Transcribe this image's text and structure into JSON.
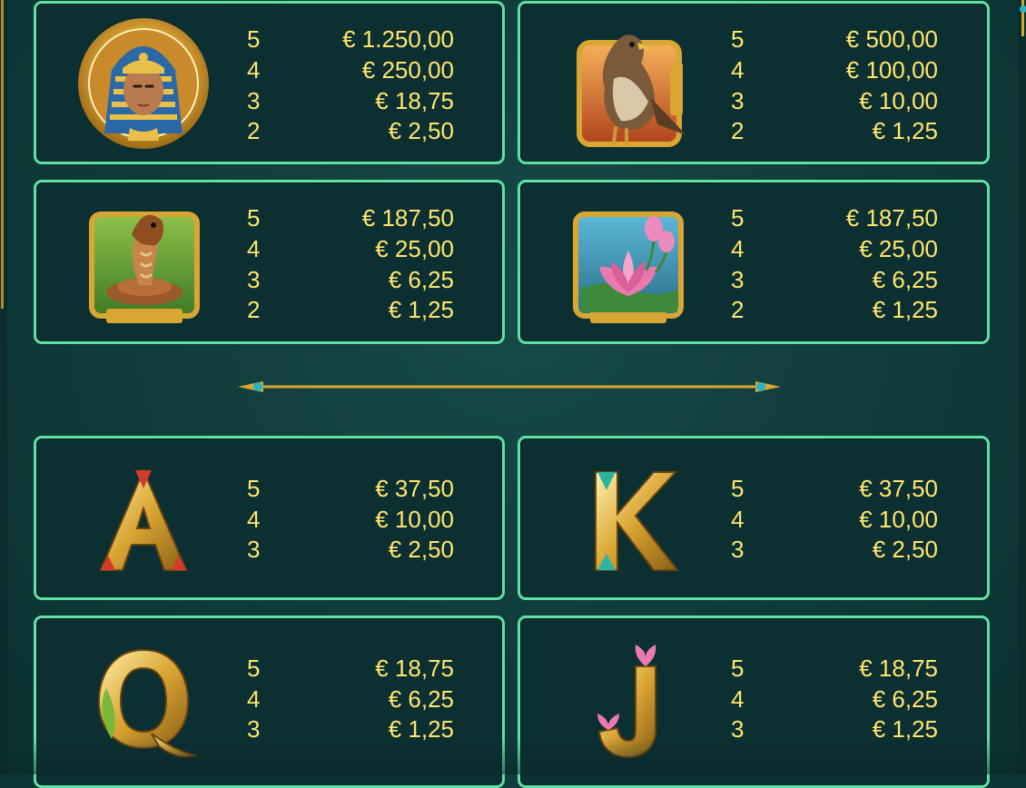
{
  "paytable": {
    "cards": [
      {
        "symbol": "pharaoh-icon",
        "rows": [
          {
            "count": "5",
            "amount": "€ 1.250,00"
          },
          {
            "count": "4",
            "amount": "€ 250,00"
          },
          {
            "count": "3",
            "amount": "€ 18,75"
          },
          {
            "count": "2",
            "amount": "€ 2,50"
          }
        ]
      },
      {
        "symbol": "falcon-icon",
        "rows": [
          {
            "count": "5",
            "amount": "€ 500,00"
          },
          {
            "count": "4",
            "amount": "€ 100,00"
          },
          {
            "count": "3",
            "amount": "€ 10,00"
          },
          {
            "count": "2",
            "amount": "€ 1,25"
          }
        ]
      },
      {
        "symbol": "cobra-icon",
        "rows": [
          {
            "count": "5",
            "amount": "€ 187,50"
          },
          {
            "count": "4",
            "amount": "€ 25,00"
          },
          {
            "count": "3",
            "amount": "€ 6,25"
          },
          {
            "count": "2",
            "amount": "€ 1,25"
          }
        ]
      },
      {
        "symbol": "lotus-icon",
        "rows": [
          {
            "count": "5",
            "amount": "€ 187,50"
          },
          {
            "count": "4",
            "amount": "€ 25,00"
          },
          {
            "count": "3",
            "amount": "€ 6,25"
          },
          {
            "count": "2",
            "amount": "€ 1,25"
          }
        ]
      },
      {
        "symbol": "letter-a-icon",
        "letter": "A",
        "rows": [
          {
            "count": "5",
            "amount": "€ 37,50"
          },
          {
            "count": "4",
            "amount": "€ 10,00"
          },
          {
            "count": "3",
            "amount": "€ 2,50"
          }
        ]
      },
      {
        "symbol": "letter-k-icon",
        "letter": "K",
        "rows": [
          {
            "count": "5",
            "amount": "€ 37,50"
          },
          {
            "count": "4",
            "amount": "€ 10,00"
          },
          {
            "count": "3",
            "amount": "€ 2,50"
          }
        ]
      },
      {
        "symbol": "letter-q-icon",
        "letter": "Q",
        "rows": [
          {
            "count": "5",
            "amount": "€ 18,75"
          },
          {
            "count": "4",
            "amount": "€ 6,25"
          },
          {
            "count": "3",
            "amount": "€ 1,25"
          }
        ]
      },
      {
        "symbol": "letter-j-icon",
        "letter": "J",
        "rows": [
          {
            "count": "5",
            "amount": "€ 18,75"
          },
          {
            "count": "4",
            "amount": "€ 6,25"
          },
          {
            "count": "3",
            "amount": "€ 1,25"
          }
        ]
      }
    ]
  },
  "colors": {
    "background": "#0f3b3a",
    "card_fill": "#0c2f31",
    "card_border": "#5fe0a4",
    "payout_text": "#ffe66e",
    "gold": "#d9a533",
    "divider_gem": "#2bb3c4"
  },
  "divider_icon": "spear-divider-icon"
}
